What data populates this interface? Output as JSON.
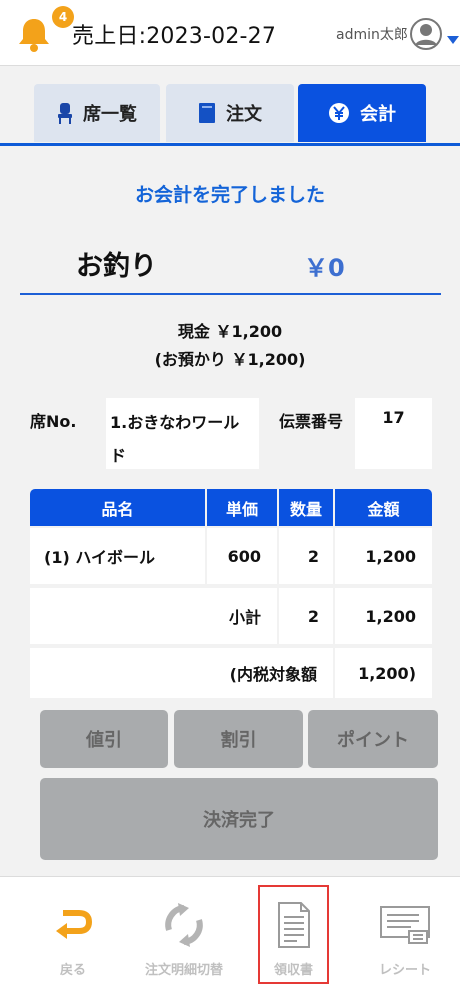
{
  "header": {
    "notification_count": "4",
    "sales_date": "売上日:2023-02-27",
    "user_name": "admin太郎",
    "colors": {
      "bell": "#f3a21a",
      "accent": "#0a52e0"
    }
  },
  "tabs": [
    {
      "label": "席一覧",
      "icon": "chair-icon",
      "active": false
    },
    {
      "label": "注文",
      "icon": "order-book-icon",
      "active": false
    },
    {
      "label": "会計",
      "icon": "yen-icon",
      "active": true
    }
  ],
  "payment": {
    "completed_message": "お会計を完了しました",
    "change_label": "お釣り",
    "change_amount": "￥0",
    "cash_line": "現金 ￥1,200",
    "deposit_line": "(お預かり ￥1,200)"
  },
  "info": {
    "seat_label": "席No.",
    "seat_value": "1.おきなわワールド",
    "slip_label": "伝票番号",
    "slip_value": "17"
  },
  "table": {
    "headers": [
      "品名",
      "単価",
      "数量",
      "金額"
    ],
    "rows": [
      {
        "name": "(1) ハイボール",
        "unit_price": "600",
        "qty": "2",
        "amount": "1,200"
      }
    ],
    "subtotal_label": "小計",
    "subtotal_qty": "2",
    "subtotal_amount": "1,200",
    "tax_label": "(内税対象額",
    "tax_amount": "1,200)"
  },
  "actions": {
    "discount_amount": "値引",
    "discount_rate": "割引",
    "points": "ポイント",
    "complete": "決済完了"
  },
  "bottom_nav": [
    {
      "label": "戻る",
      "icon": "return-arrow-icon"
    },
    {
      "label": "注文明細切替",
      "icon": "refresh-icon"
    },
    {
      "label": "領収書",
      "icon": "receipt-document-icon",
      "highlighted": true
    },
    {
      "label": "レシート",
      "icon": "printer-receipt-icon"
    }
  ]
}
